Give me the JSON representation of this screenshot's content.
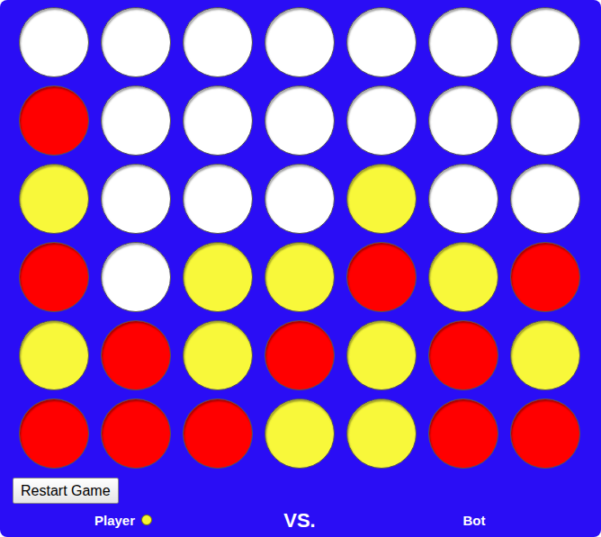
{
  "board": {
    "rows": [
      [
        {
          "piece": "empty"
        },
        {
          "piece": "empty"
        },
        {
          "piece": "empty"
        },
        {
          "piece": "empty"
        },
        {
          "piece": "empty"
        },
        {
          "piece": "empty"
        },
        {
          "piece": "empty"
        }
      ],
      [
        {
          "piece": "red"
        },
        {
          "piece": "empty"
        },
        {
          "piece": "empty"
        },
        {
          "piece": "empty"
        },
        {
          "piece": "empty"
        },
        {
          "piece": "empty"
        },
        {
          "piece": "empty"
        }
      ],
      [
        {
          "piece": "yellow"
        },
        {
          "piece": "empty"
        },
        {
          "piece": "empty"
        },
        {
          "piece": "empty"
        },
        {
          "piece": "yellow"
        },
        {
          "piece": "empty"
        },
        {
          "piece": "empty"
        }
      ],
      [
        {
          "piece": "red"
        },
        {
          "piece": "empty"
        },
        {
          "piece": "yellow"
        },
        {
          "piece": "yellow"
        },
        {
          "piece": "red"
        },
        {
          "piece": "yellow"
        },
        {
          "piece": "red"
        }
      ],
      [
        {
          "piece": "yellow"
        },
        {
          "piece": "red"
        },
        {
          "piece": "yellow"
        },
        {
          "piece": "red"
        },
        {
          "piece": "yellow"
        },
        {
          "piece": "red"
        },
        {
          "piece": "yellow"
        }
      ],
      [
        {
          "piece": "red"
        },
        {
          "piece": "red"
        },
        {
          "piece": "red"
        },
        {
          "piece": "yellow"
        },
        {
          "piece": "yellow"
        },
        {
          "piece": "red"
        },
        {
          "piece": "red"
        }
      ]
    ]
  },
  "restart_button": "Restart Game",
  "versus": "VS.",
  "players": [
    {
      "name": "Player",
      "active": true,
      "color": "#f5f52e"
    },
    {
      "name": "Bot",
      "active": false,
      "color": "#ff0000"
    }
  ]
}
